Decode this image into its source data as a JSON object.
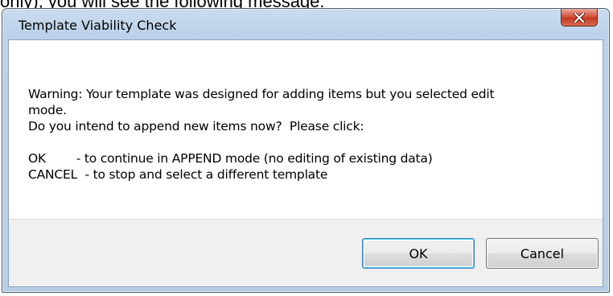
{
  "page_caption": "only), you will see the following message:",
  "window": {
    "title": "Template Viability Check",
    "close_icon": "close-icon"
  },
  "message": {
    "lines": [
      "Warning: Your template was designed for adding items but you selected edit",
      "mode.",
      "Do you intend to append new items now?  Please click:",
      "",
      "OK        - to continue in APPEND mode (no editing of existing data)",
      "CANCEL  - to stop and select a different template"
    ]
  },
  "buttons": {
    "ok_label": "OK",
    "cancel_label": "Cancel"
  },
  "colors": {
    "title_bar": "#bcd2ea",
    "close_button": "#c13a22",
    "button_row": "#f0f0f0",
    "ok_focus_border": "#3c7fb1"
  }
}
